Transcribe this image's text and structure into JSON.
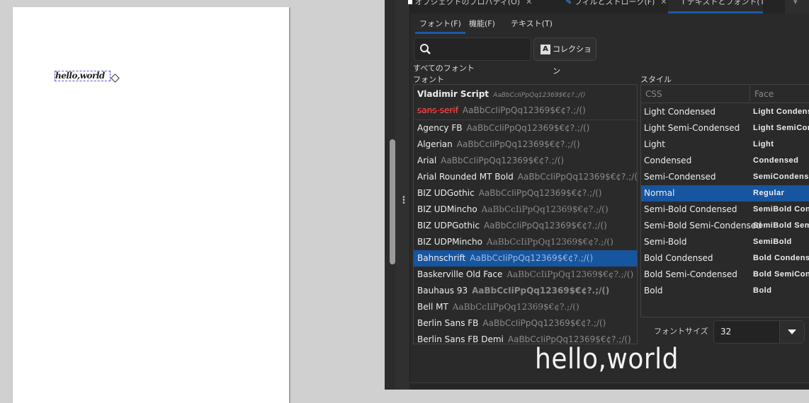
{
  "canvas": {
    "text": "hello,world"
  },
  "dock_tabs": [
    {
      "label": "オブジェクトのプロパティ(O)",
      "icon": "object-properties-icon"
    },
    {
      "label": "フィルとストローク(F)",
      "icon": "fill-stroke-icon"
    },
    {
      "label": "テキストとフォント(T)",
      "icon": "text-cursor-icon",
      "active": true
    }
  ],
  "close_glyph": "✕",
  "sub_tabs": [
    {
      "label": "フォント(F)",
      "active": true
    },
    {
      "label": "機能(F)"
    },
    {
      "label": "テキスト(T)"
    }
  ],
  "search": {
    "value": "",
    "placeholder": ""
  },
  "collection_button": "コレクション",
  "all_fonts_label": "すべてのフォント",
  "font_label": "フォント",
  "style_label": "スタイル",
  "sample": "AaBbCcIiPpQq12369$€¢?.;/()",
  "fonts": [
    "Vladimir Script",
    "sans-serif",
    "Agency FB",
    "Algerian",
    "Arial",
    "Arial Rounded MT Bold",
    "BIZ UDGothic",
    "BIZ UDMincho",
    "BIZ UDPGothic",
    "BIZ UDPMincho",
    "Bahnschrift",
    "Baskerville Old Face",
    "Bauhaus 93",
    "Bell MT",
    "Berlin Sans FB",
    "Berlin Sans FB Demi"
  ],
  "selected_font": "Bahnschrift",
  "style_columns": [
    "CSS",
    "Face"
  ],
  "styles": [
    [
      "Light Condensed",
      "Light Condensed"
    ],
    [
      "Light Semi-Condensed",
      "Light SemiCondensed"
    ],
    [
      "Light",
      "Light"
    ],
    [
      "Condensed",
      "Condensed"
    ],
    [
      "Semi-Condensed",
      "SemiCondensed"
    ],
    [
      "Normal",
      "Regular"
    ],
    [
      "Semi-Bold Condensed",
      "SemiBold Condensed"
    ],
    [
      "Semi-Bold Semi-Condensed",
      "SemiBold SemiCondensed"
    ],
    [
      "Semi-Bold",
      "SemiBold"
    ],
    [
      "Bold Condensed",
      "Bold Condensed"
    ],
    [
      "Bold Semi-Condensed",
      "Bold SemiCondensed"
    ],
    [
      "Bold",
      "Bold"
    ]
  ],
  "selected_style": "Normal",
  "font_size_label": "フォントサイズ",
  "font_size": "32",
  "preview_text": "hello,world",
  "colors": {
    "accent": "#1655a0",
    "panel_bg": "#2a2a2a",
    "canvas_bg": "#d0d0d0"
  }
}
